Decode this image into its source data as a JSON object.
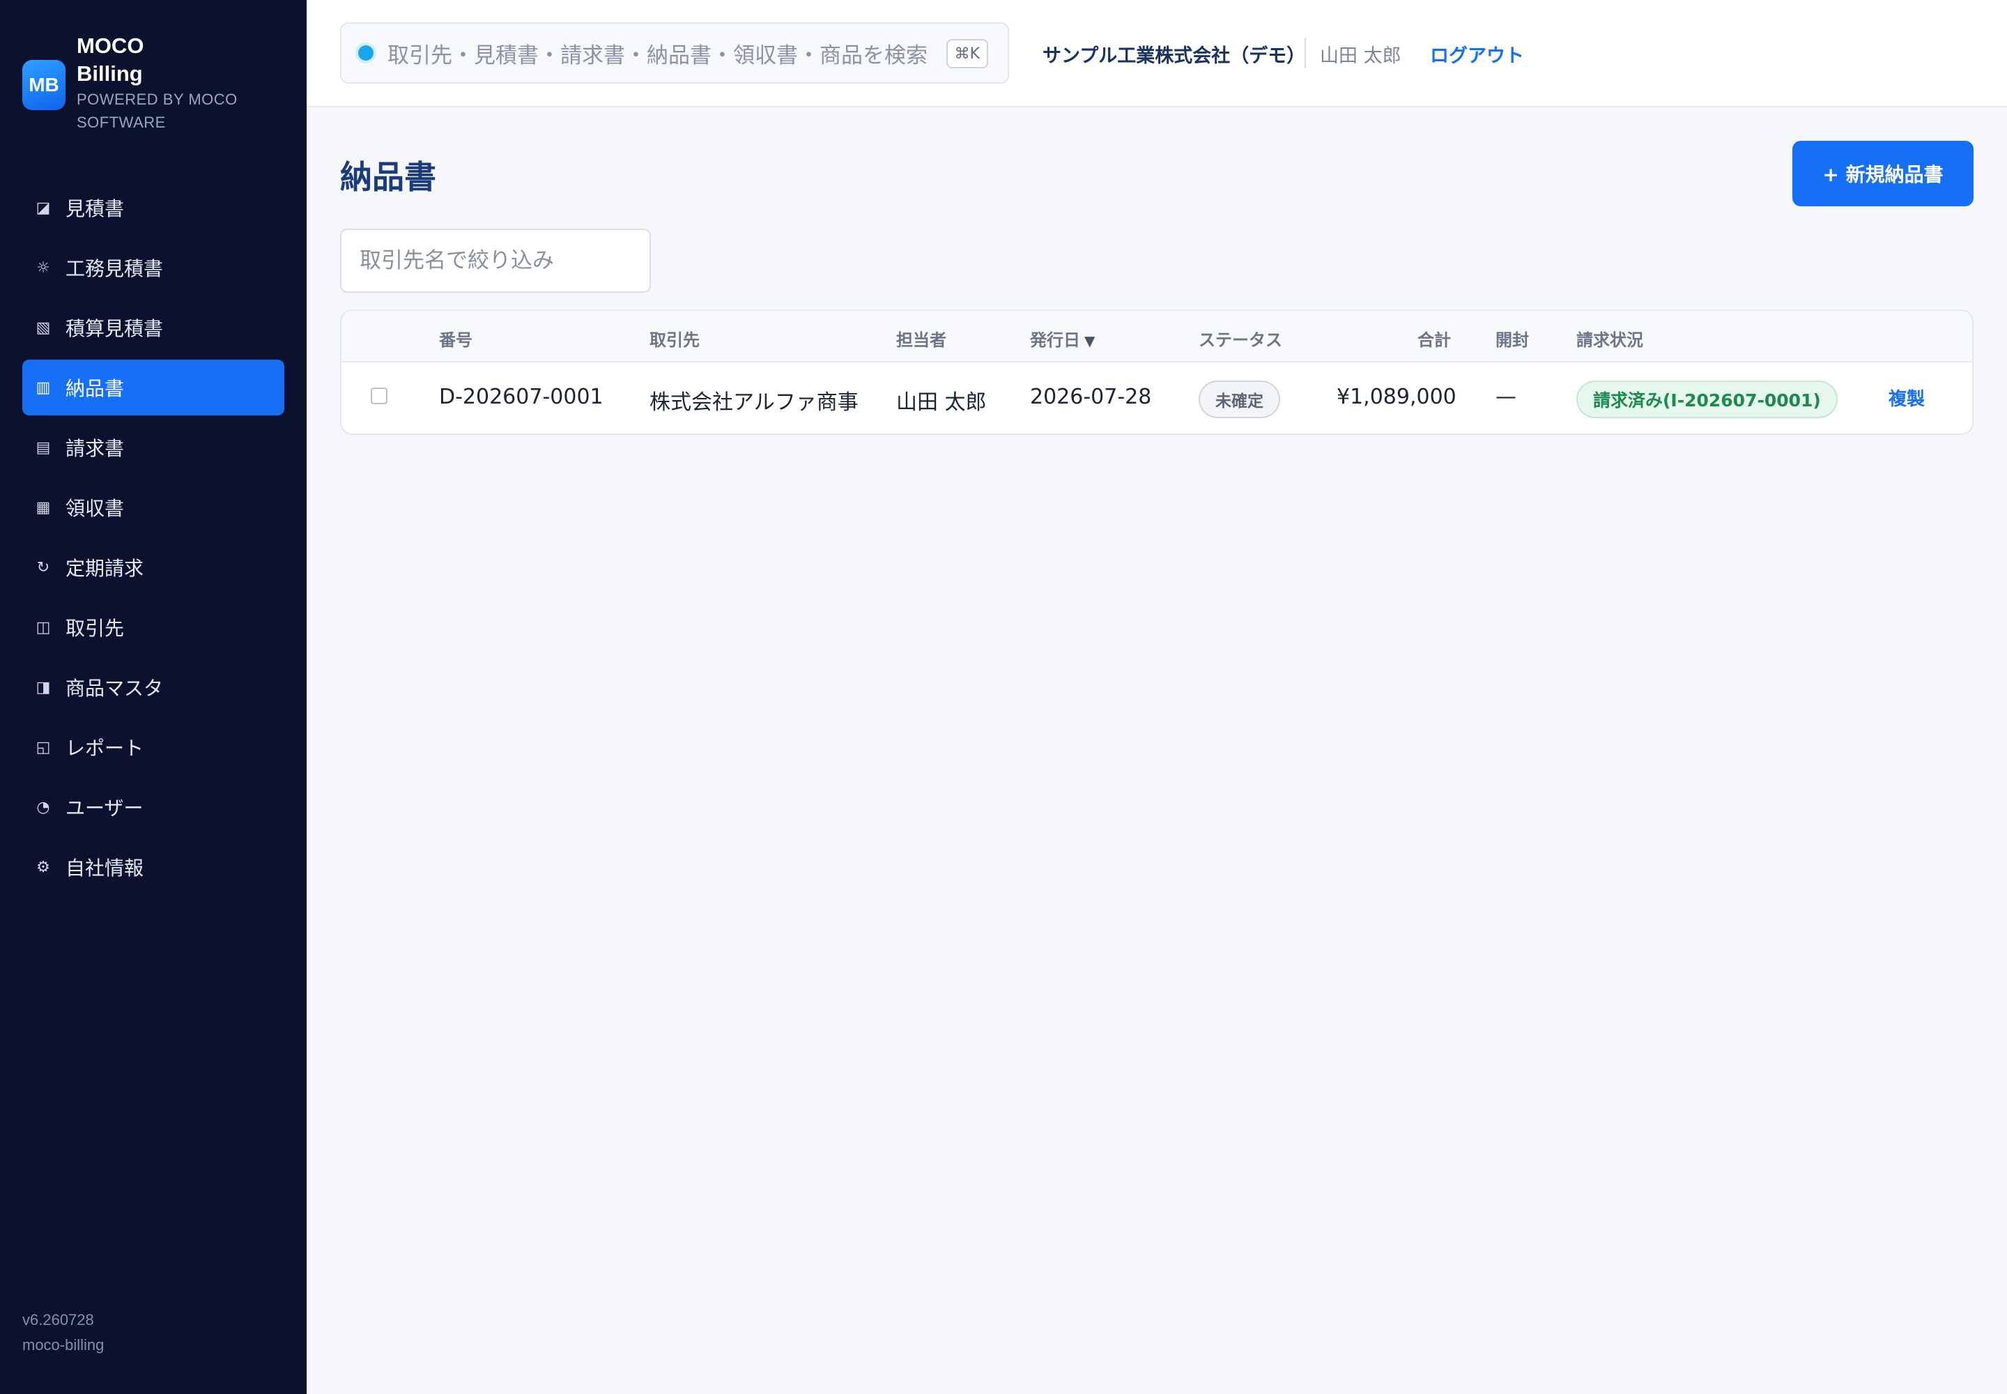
{
  "brand": {
    "logo_text": "MB",
    "name": "MOCO Billing",
    "subtitle": "POWERED BY MOCO SOFTWARE"
  },
  "sidebar": {
    "items": [
      {
        "label": "見積書",
        "icon": "quote-icon",
        "glyph": "◪",
        "active": false
      },
      {
        "label": "工務見積書",
        "icon": "construction-quote-icon",
        "glyph": "☼",
        "active": false
      },
      {
        "label": "積算見積書",
        "icon": "estimate-icon",
        "glyph": "▧",
        "active": false
      },
      {
        "label": "納品書",
        "icon": "delivery-note-icon",
        "glyph": "▥",
        "active": true
      },
      {
        "label": "請求書",
        "icon": "invoice-icon",
        "glyph": "▤",
        "active": false
      },
      {
        "label": "領収書",
        "icon": "receipt-icon",
        "glyph": "▦",
        "active": false
      },
      {
        "label": "定期請求",
        "icon": "recurring-icon",
        "glyph": "↻",
        "active": false
      },
      {
        "label": "取引先",
        "icon": "clients-icon",
        "glyph": "◫",
        "active": false
      },
      {
        "label": "商品マスタ",
        "icon": "products-icon",
        "glyph": "◨",
        "active": false
      },
      {
        "label": "レポート",
        "icon": "report-icon",
        "glyph": "◱",
        "active": false
      },
      {
        "label": "ユーザー",
        "icon": "users-icon",
        "glyph": "◔",
        "active": false
      },
      {
        "label": "自社情報",
        "icon": "company-settings-icon",
        "glyph": "⚙",
        "active": false
      }
    ],
    "version": "v6.260728",
    "app_id": "moco-billing"
  },
  "header": {
    "search_placeholder": "取引先・見積書・請求書・納品書・領収書・商品を検索",
    "shortcut": "⌘K",
    "company": "サンプル工業株式会社（デモ）",
    "user": "山田 太郎",
    "logout": "ログアウト"
  },
  "main": {
    "title": "納品書",
    "new_button": "+ 新規納品書",
    "filter_placeholder": "取引先名で絞り込み",
    "table": {
      "columns": [
        "番号",
        "取引先",
        "担当者",
        "発行日",
        "ステータス",
        "合計",
        "開封",
        "請求状況"
      ],
      "sort_indicator": "▼",
      "rows": [
        {
          "number": "D-202607-0001",
          "client": "株式会社アルファ商事",
          "owner": "山田 太郎",
          "issue_date": "2026-07-28",
          "status": "未確定",
          "total": "¥1,089,000",
          "opened": "—",
          "billing_status": "請求済み(I-202607-0001)",
          "action": "複製"
        }
      ]
    }
  },
  "colors": {
    "sidebar_bg": "#0b1230",
    "accent": "#1570f5",
    "title": "#1a3c7a",
    "success": "#1b8a4e"
  }
}
